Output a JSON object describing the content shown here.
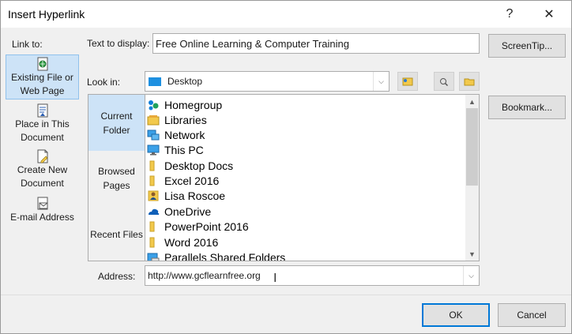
{
  "window": {
    "title": "Insert Hyperlink",
    "help_label": "?",
    "close_label": "✕"
  },
  "link_to": {
    "label": "Link to:",
    "items": [
      {
        "label_line1": "Existing File or",
        "label_line2": "Web Page",
        "icon": "existing-file-icon",
        "selected": true
      },
      {
        "label_line1": "Place in This",
        "label_line2": "Document",
        "icon": "place-in-document-icon",
        "selected": false
      },
      {
        "label_line1": "Create New",
        "label_line2": "Document",
        "icon": "new-document-icon",
        "selected": false
      },
      {
        "label_line1": "E-mail Address",
        "label_line2": "",
        "icon": "email-icon",
        "selected": false
      }
    ]
  },
  "text_to_display": {
    "label": "Text to display:",
    "value": "Free Online Learning & Computer Training"
  },
  "screentip_button": "ScreenTip...",
  "bookmark_button": "Bookmark...",
  "look_in": {
    "label": "Look in:",
    "value": "Desktop",
    "icons": [
      "browse-web-icon",
      "browse-file-icon",
      "recent-folder-icon"
    ]
  },
  "side_tabs": [
    {
      "label_line1": "Current",
      "label_line2": "Folder",
      "selected": true
    },
    {
      "label_line1": "Browsed",
      "label_line2": "Pages",
      "selected": false
    },
    {
      "label_line1": "Recent Files",
      "label_line2": "",
      "selected": false
    }
  ],
  "files": [
    {
      "name": "Homegroup",
      "icon": "homegroup-icon"
    },
    {
      "name": "Libraries",
      "icon": "libraries-icon"
    },
    {
      "name": "Network",
      "icon": "network-icon"
    },
    {
      "name": "This PC",
      "icon": "this-pc-icon"
    },
    {
      "name": "Desktop Docs",
      "icon": "folder-icon"
    },
    {
      "name": "Excel 2016",
      "icon": "folder-icon"
    },
    {
      "name": "Lisa Roscoe",
      "icon": "user-folder-icon"
    },
    {
      "name": "OneDrive",
      "icon": "onedrive-icon"
    },
    {
      "name": "PowerPoint 2016",
      "icon": "folder-icon"
    },
    {
      "name": "Word 2016",
      "icon": "folder-icon"
    },
    {
      "name": "Parallels Shared Folders",
      "icon": "shared-folder-icon"
    }
  ],
  "address": {
    "label": "Address:",
    "value": "http://www.gcflearnfree.org"
  },
  "ok_button": "OK",
  "cancel_button": "Cancel",
  "colors": {
    "selection": "#cde3f7",
    "selection_border": "#90c1ec",
    "default_button_border": "#0078d7",
    "folder_yellow": "#f2c94c"
  }
}
